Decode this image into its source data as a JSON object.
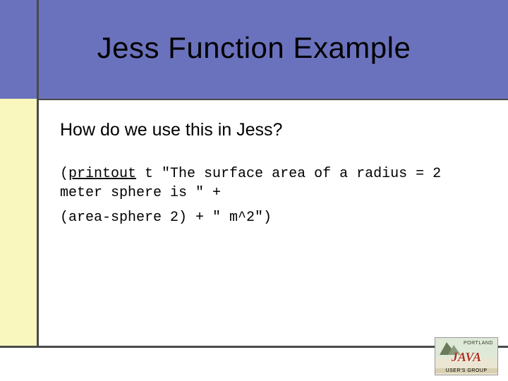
{
  "title": "Jess Function Example",
  "question": "How do we use this in Jess?",
  "code": {
    "keyword": "printout",
    "line1_rest": " t \"The surface area of a radius = 2 meter sphere is \" +",
    "line2": "(area-sphere 2) + \" m^2\")"
  },
  "logo": {
    "top_label": "PORTLAND",
    "brand": "JAVA",
    "subtitle": "USER'S GROUP"
  }
}
